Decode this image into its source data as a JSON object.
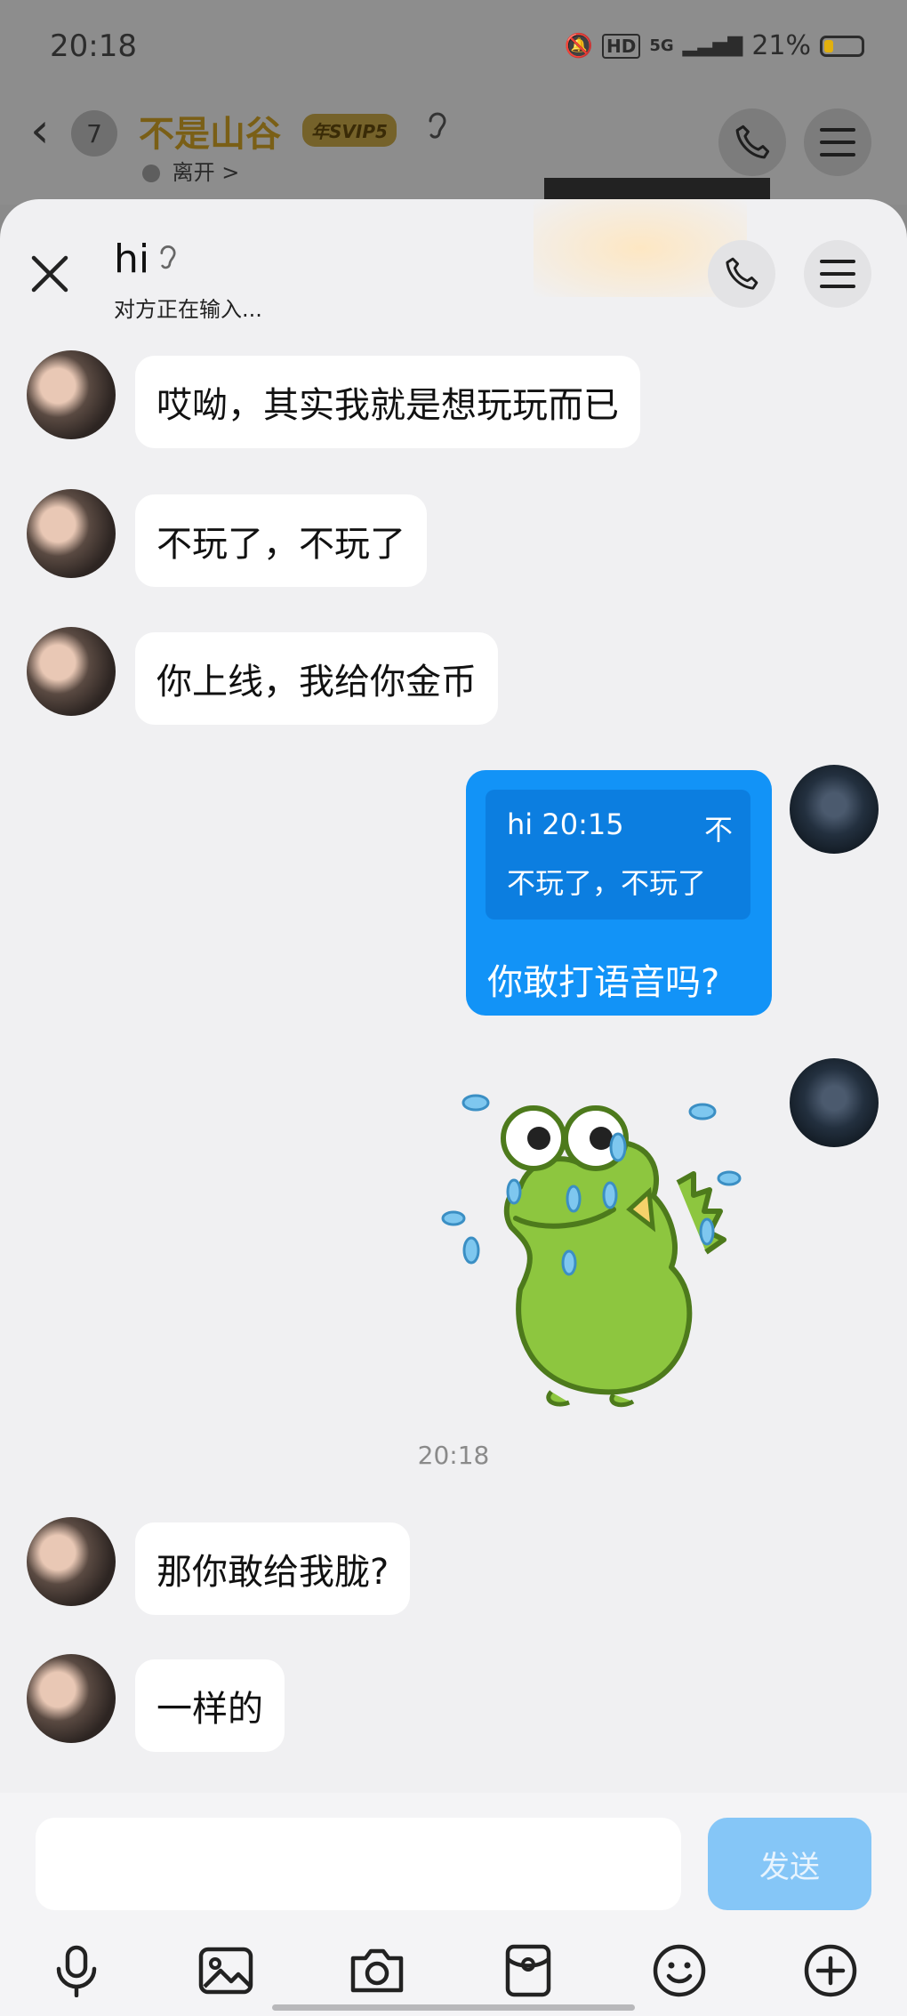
{
  "status_bar": {
    "time": "20:18",
    "network": "5G",
    "battery": "21%"
  },
  "background_chat": {
    "unread_count": "7",
    "title": "不是山谷",
    "vip_badge": "年SVIP5",
    "status": "离开 >"
  },
  "chat": {
    "name": "hi",
    "typing_status": "对方正在输入..."
  },
  "messages": [
    {
      "side": "left",
      "text": "哎呦，其实我就是想玩玩而已"
    },
    {
      "side": "left",
      "text": "不玩了，不玩了"
    },
    {
      "side": "left",
      "text": "你上线，我给你金币"
    },
    {
      "side": "right",
      "quote_header": "hi 20:15",
      "quote_tail": "不",
      "quote_body": "不玩了，不玩了",
      "text": "你敢打语音吗?"
    },
    {
      "side": "right",
      "sticker": "frog-sweating-sticker"
    },
    {
      "timestamp": "20:18"
    },
    {
      "side": "left",
      "text": "那你敢给我胧?"
    },
    {
      "side": "left",
      "text": "一样的"
    }
  ],
  "composer": {
    "input_value": "",
    "send_label": "发送"
  },
  "toolbar_icons": [
    "microphone-icon",
    "image-icon",
    "camera-icon",
    "red-packet-icon",
    "emoji-icon",
    "plus-icon"
  ],
  "colors": {
    "bubble_self": "#1293f7",
    "send_disabled": "#85c6f7",
    "vip_gold": "#7a5f16"
  }
}
